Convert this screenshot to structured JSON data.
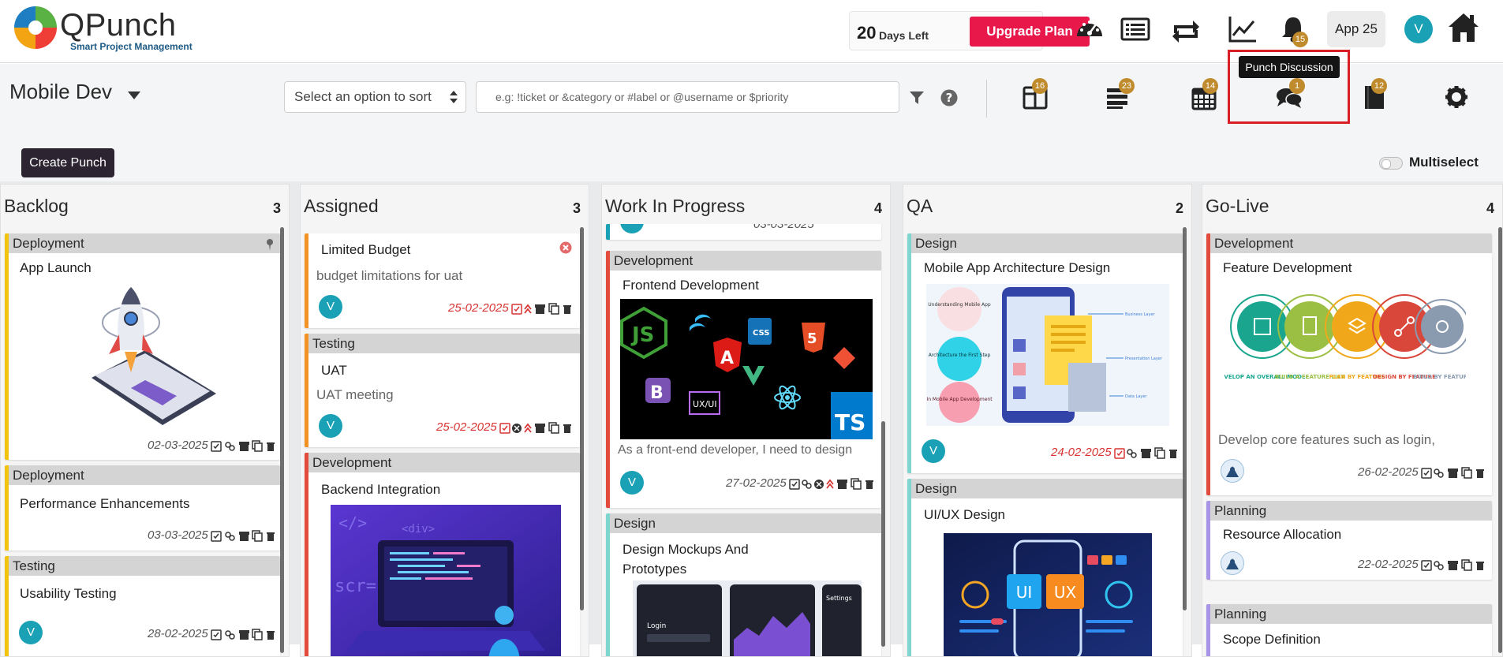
{
  "brand": {
    "name": "QPunch",
    "tagline": "Smart Project Management"
  },
  "trial": {
    "days": "20",
    "days_label": "Days Left",
    "upgrade_label": "Upgrade Plan"
  },
  "header": {
    "notifications_badge": "15",
    "app_label": "App 25",
    "user_initial": "V"
  },
  "tooltip": "Punch Discussion",
  "project": {
    "name": "Mobile Dev"
  },
  "sort": {
    "placeholder": "Select an option to sort"
  },
  "search": {
    "placeholder": "e.g: !ticket or &category or #label or @username or $priority"
  },
  "toolbar_badges": {
    "cards": "16",
    "list": "23",
    "calendar": "14",
    "discussion": "1",
    "notes": "12"
  },
  "actions": {
    "create_label": "Create Punch",
    "multiselect_label": "Multiselect"
  },
  "colors": {
    "accent_red": "#e8194a",
    "badge": "#c08b2c",
    "avatar": "#1ba1b5",
    "dark_button": "#2c2430"
  },
  "columns": [
    {
      "title": "Backlog",
      "count": "3",
      "cards": [
        {
          "category": "Deployment",
          "title": "App Launch",
          "date": "02-03-2025"
        },
        {
          "category": "Deployment",
          "title": "Performance Enhancements",
          "date": "03-03-2025"
        },
        {
          "category": "Testing",
          "title": "Usability Testing",
          "date": "28-02-2025",
          "avatar": "V"
        }
      ]
    },
    {
      "title": "Assigned",
      "count": "3",
      "cards": [
        {
          "title": "Limited Budget",
          "desc": "budget limitations for uat",
          "date": "25-02-2025",
          "avatar": "V"
        },
        {
          "category": "Testing",
          "title": "UAT",
          "desc": "UAT meeting",
          "date": "25-02-2025",
          "avatar": "V"
        },
        {
          "category": "Development",
          "title": "Backend Integration"
        }
      ]
    },
    {
      "title": "Work In Progress",
      "count": "4",
      "cards": [
        {
          "date": "03-03-2025"
        },
        {
          "category": "Development",
          "title": "Frontend Development",
          "desc": "As a front-end developer, I need to design",
          "date": "27-02-2025",
          "avatar": "V",
          "tech_labels": {
            "ui_ux": "UX/UI",
            "ts": "TS",
            "css": "CSS",
            "bootstrap": "B"
          }
        },
        {
          "category": "Design",
          "title": "Design Mockups And Prototypes",
          "login_label": "Login",
          "settings_label": "Settings"
        }
      ]
    },
    {
      "title": "QA",
      "count": "2",
      "cards": [
        {
          "category": "Design",
          "title": "Mobile App Architecture Design",
          "date": "24-02-2025",
          "avatar": "V",
          "diagram": {
            "steps": [
              "Understanding Mobile App",
              "Architecture the First Step",
              "In Mobile App Development"
            ],
            "layers": [
              "Business Layer",
              "Presentation Layer",
              "Data Layer"
            ]
          }
        },
        {
          "category": "Design",
          "title": "UI/UX Design",
          "ui_label": "UI",
          "ux_label": "UX"
        }
      ]
    },
    {
      "title": "Go-Live",
      "count": "4",
      "cards": [
        {
          "category": "Development",
          "title": "Feature Development",
          "desc": "Develop core features such as login,",
          "date": "26-02-2025",
          "steps": [
            "DEVELOP AN OVERALL MODEL",
            "BUILD A FEATURE LIST",
            "PLAN BY FEATURE",
            "DESIGN BY FEATURE",
            "BUILD BY FEATURE"
          ]
        },
        {
          "category": "Planning",
          "title": "Resource Allocation",
          "date": "22-02-2025"
        },
        {
          "category": "Planning",
          "title": "Scope Definition"
        }
      ]
    }
  ]
}
